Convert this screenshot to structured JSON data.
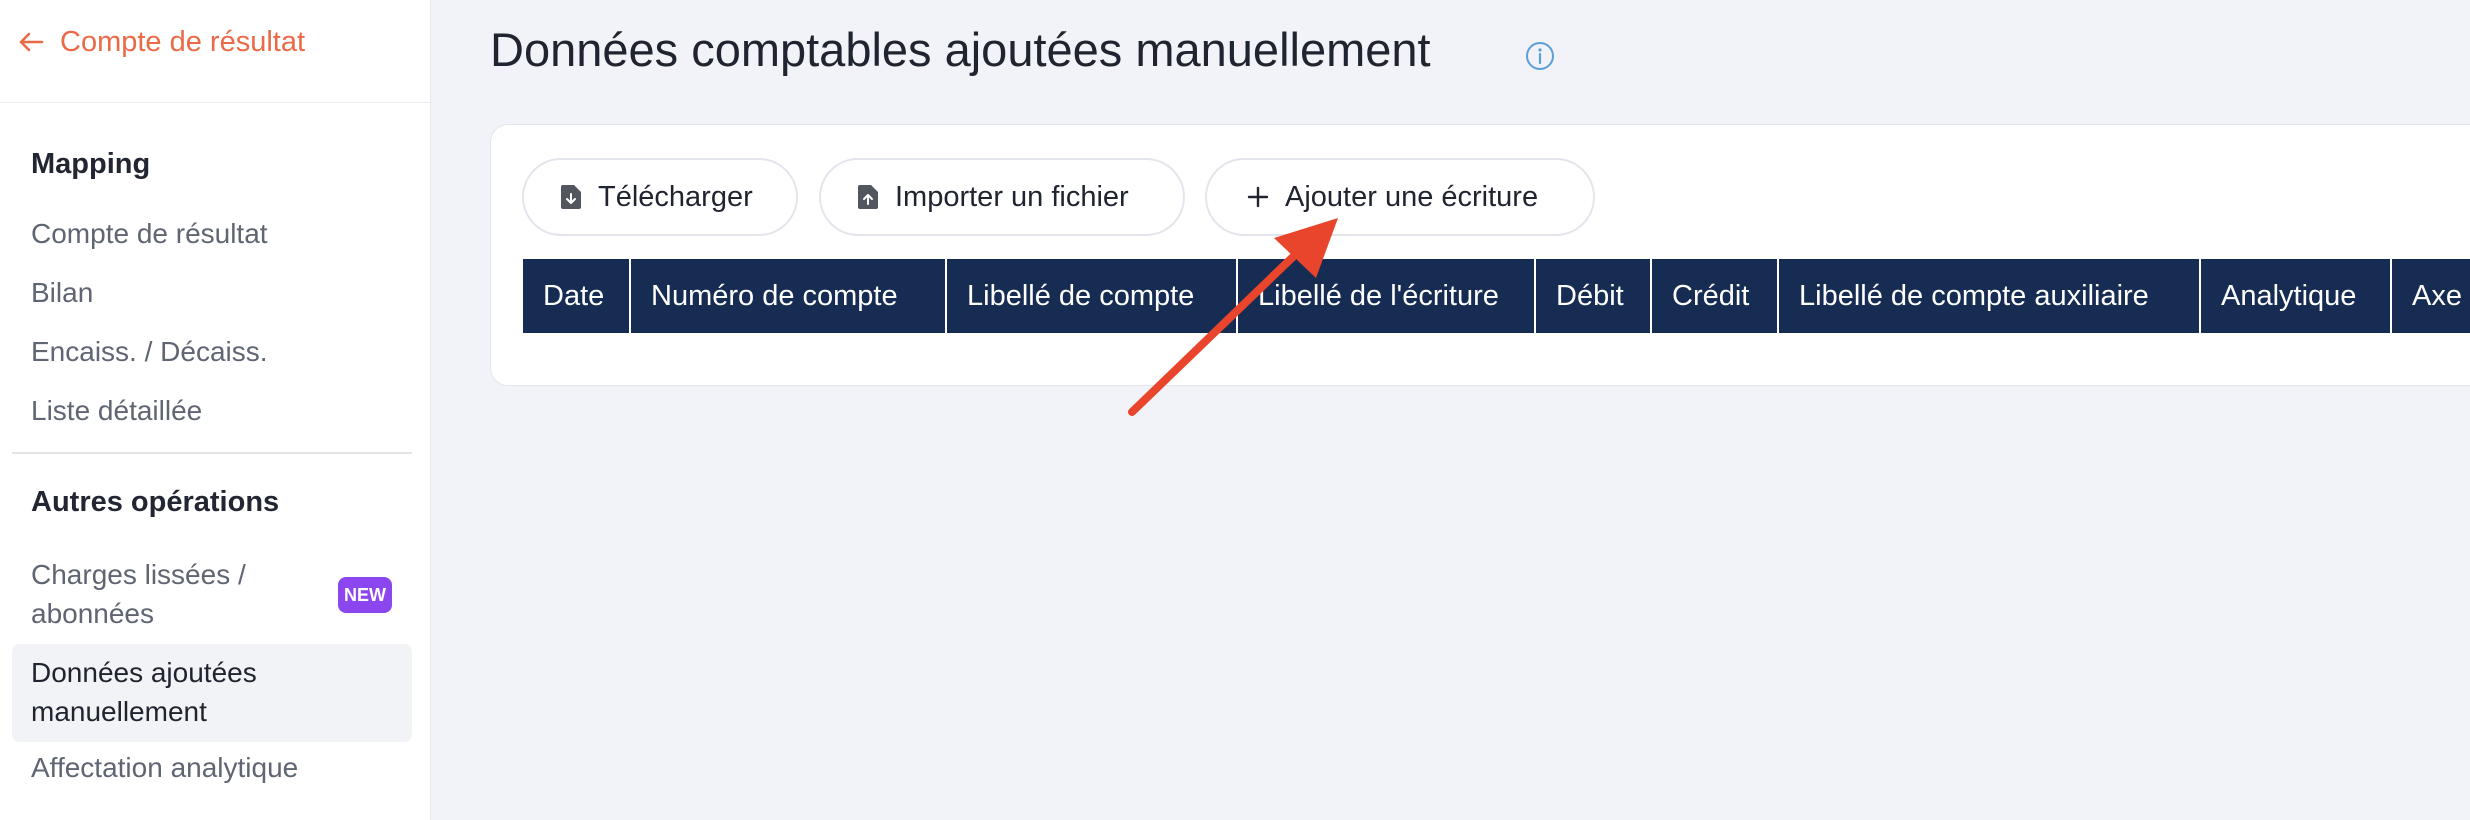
{
  "sidebar": {
    "back_label": "Compte de résultat",
    "sections": [
      {
        "title": "Mapping",
        "items": [
          "Compte de résultat",
          "Bilan",
          "Encaiss. / Décaiss.",
          "Liste détaillée"
        ]
      },
      {
        "title": "Autres opérations",
        "items": [
          {
            "line1": "Charges lissées /",
            "line2": "abonnées",
            "badge": "NEW"
          },
          {
            "line1": "Données ajoutées",
            "line2": "manuellement",
            "active": true
          },
          {
            "label": "Affectation analytique"
          }
        ]
      }
    ]
  },
  "main": {
    "title": "Données comptables ajoutées manuellement",
    "buttons": {
      "download": "Télécharger",
      "import": "Importer un fichier",
      "add": "Ajouter une écriture"
    },
    "table": {
      "headers": [
        "Date",
        "Numéro de compte",
        "Libellé de compte",
        "Libellé de l'écriture",
        "Débit",
        "Crédit",
        "Libellé de compte auxiliaire",
        "Analytique",
        "Axe"
      ]
    }
  },
  "colors": {
    "accent": "#ea6a47",
    "table_header": "#172c52",
    "badge": "#8b46ef",
    "annotation_arrow": "#e8452c",
    "info_icon": "#5b9fd8"
  },
  "icons": [
    "arrow-left-icon",
    "info-icon",
    "file-download-icon",
    "file-upload-icon",
    "plus-icon",
    "annotation-arrow-icon"
  ]
}
